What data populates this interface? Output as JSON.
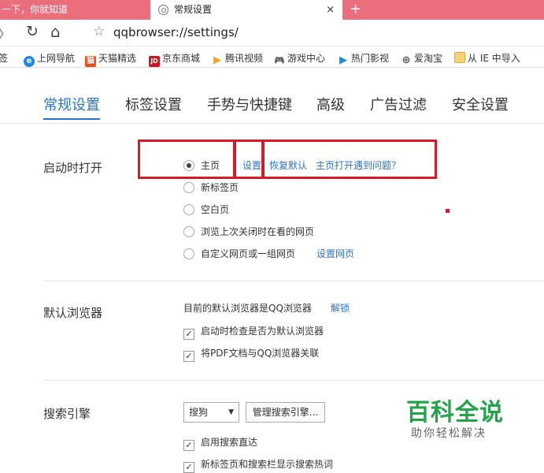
{
  "tabs": {
    "inactive_title": "一下，你就知道",
    "active_title": "常规设置",
    "close": "×",
    "new_tab": "+"
  },
  "address": {
    "url": "qqbrowser://settings/"
  },
  "bookmarks": [
    {
      "label": "签",
      "icon": "",
      "color": ""
    },
    {
      "label": "上网导航",
      "icon": "e",
      "color": "#1e88e5"
    },
    {
      "label": "天猫精选",
      "icon": "猫",
      "color": "#e8511a"
    },
    {
      "label": "京东商城",
      "icon": "JD",
      "color": "#c9151e"
    },
    {
      "label": "腾讯视频",
      "icon": "▶",
      "color": "#f5a623"
    },
    {
      "label": "游戏中心",
      "icon": "🎮",
      "color": "#22a84a"
    },
    {
      "label": "热门影视",
      "icon": "▶",
      "color": "#1e88e5"
    },
    {
      "label": "爱淘宝",
      "icon": "⊕",
      "color": "#555555"
    },
    {
      "label": "从 IE 中导入",
      "icon": "",
      "color": "#e9b84a"
    }
  ],
  "nav_tabs": [
    "常规设置",
    "标签设置",
    "手势与快捷键",
    "高级",
    "广告过滤",
    "安全设置"
  ],
  "startup": {
    "label": "启动时打开",
    "options": [
      "主页",
      "新标签页",
      "空白页",
      "浏览上次关闭时在看的网页",
      "自定义网页或一组网页"
    ],
    "selected": "主页",
    "setup_link": "设置",
    "restore_link": "恢复默认",
    "problem_link": "主页打开遇到问题？",
    "set_pages_link": "设置网页"
  },
  "default_browser": {
    "label": "默认浏览器",
    "status": "目前的默认浏览器是QQ浏览器",
    "unbind": "解锁",
    "check_on_start": "启动时检查是否为默认浏览器",
    "pdf_assoc": "将PDF文档与QQ浏览器关联"
  },
  "search": {
    "label": "搜索引擎",
    "engine": "搜狗",
    "manage": "管理搜索引擎...",
    "direct": "启用搜索直达",
    "hot_words": "新标签页和搜索栏显示搜索热词"
  },
  "watermark": {
    "title": "百科全说",
    "subtitle": "助你轻松解决"
  },
  "colors": {
    "accent": "#2a73c8",
    "tab_bar": "#eb6e7c",
    "highlight": "#d71a2a",
    "watermark": "#25a34a"
  }
}
